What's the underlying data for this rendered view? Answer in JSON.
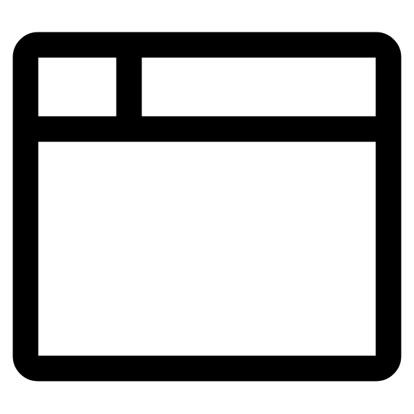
{
  "icon": {
    "name": "browser-window-icon",
    "stroke_color": "#000000",
    "fill_color": "#ffffff",
    "background_color": "#ffffff"
  }
}
